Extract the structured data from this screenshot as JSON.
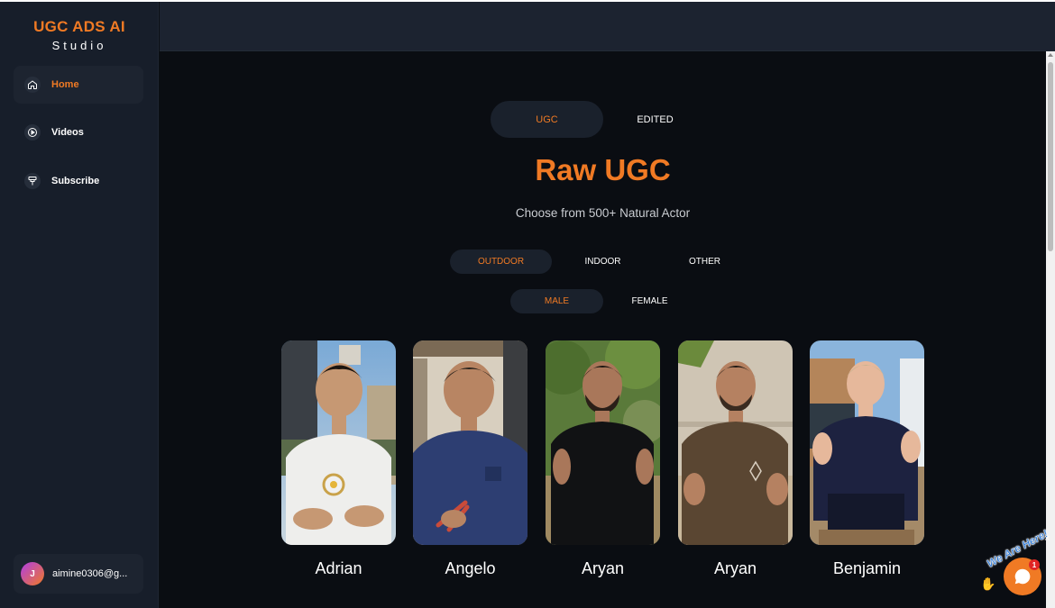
{
  "app": {
    "logo_main": "UGC ADS AI",
    "logo_sub": "Studio",
    "brand_color": "#f07a24"
  },
  "sidebar": {
    "items": [
      {
        "label": "Home",
        "icon": "home-icon",
        "active": true
      },
      {
        "label": "Videos",
        "icon": "play-circle-icon",
        "active": false
      },
      {
        "label": "Subscribe",
        "icon": "subscribe-icon",
        "active": false
      }
    ],
    "user": {
      "initial": "J",
      "email": "aimine0306@g..."
    }
  },
  "main": {
    "mode_tabs": [
      {
        "label": "UGC",
        "active": true
      },
      {
        "label": "EDITED",
        "active": false
      }
    ],
    "title": "Raw UGC",
    "subtitle": "Choose from 500+ Natural Actor",
    "setting_tabs": [
      {
        "label": "OUTDOOR",
        "active": true
      },
      {
        "label": "INDOOR",
        "active": false
      },
      {
        "label": "OTHER",
        "active": false
      }
    ],
    "gender_tabs": [
      {
        "label": "MALE",
        "active": true
      },
      {
        "label": "FEMALE",
        "active": false
      }
    ],
    "actors": [
      {
        "name": "Adrian",
        "shirt": "white tee with daisy",
        "bg": "outdoor street"
      },
      {
        "name": "Angelo",
        "shirt": "navy tee",
        "bg": "outdoor patio"
      },
      {
        "name": "Aryan",
        "shirt": "black tee",
        "bg": "trees"
      },
      {
        "name": "Aryan",
        "shirt": "brown tee",
        "bg": "wall"
      },
      {
        "name": "Benjamin",
        "shirt": "navy sweatshirt",
        "bg": "building"
      }
    ]
  },
  "chat_widget": {
    "text": "We Are Here!",
    "badge": "1",
    "close": "×"
  }
}
